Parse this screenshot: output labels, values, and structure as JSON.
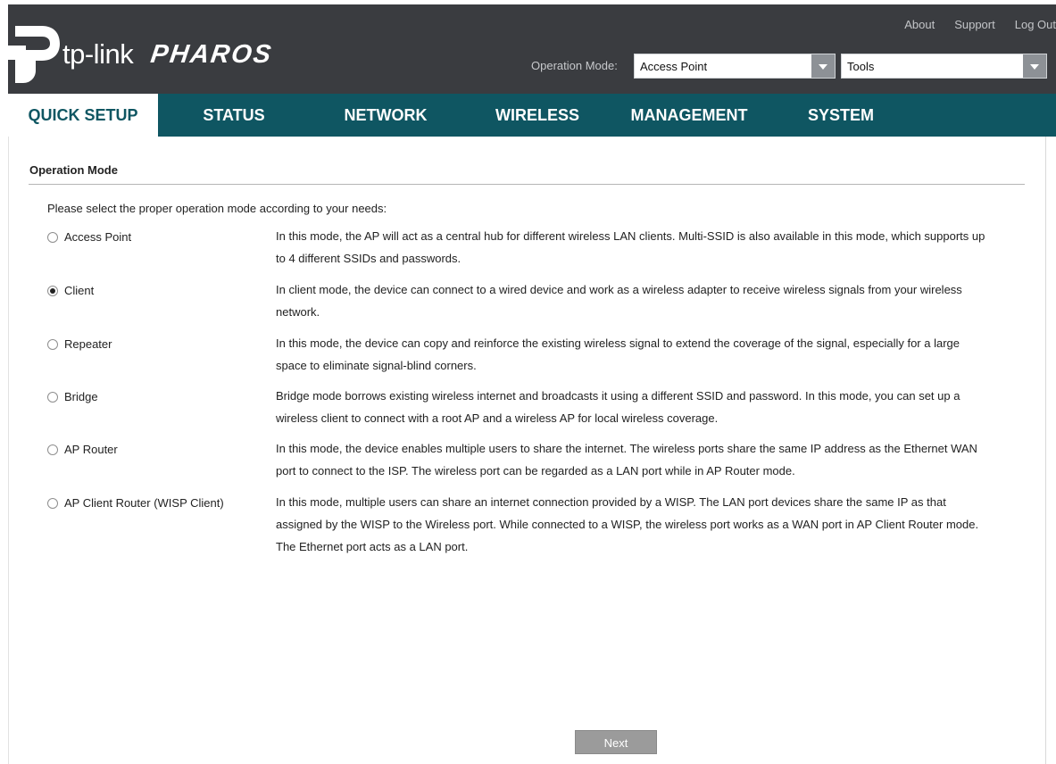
{
  "header": {
    "brand": "tp-link",
    "product": "PHAROS",
    "links": [
      "About",
      "Support",
      "Log Out"
    ],
    "operation_mode_label": "Operation Mode:",
    "operation_mode_value": "Access Point",
    "tools_value": "Tools"
  },
  "nav": {
    "tabs": [
      {
        "label": "QUICK SETUP",
        "active": true
      },
      {
        "label": "STATUS",
        "active": false
      },
      {
        "label": "NETWORK",
        "active": false
      },
      {
        "label": "WIRELESS",
        "active": false
      },
      {
        "label": "MANAGEMENT",
        "active": false
      },
      {
        "label": "SYSTEM",
        "active": false
      }
    ]
  },
  "main": {
    "section_title": "Operation Mode",
    "intro": "Please select the proper operation mode according to your needs:",
    "modes": [
      {
        "label": "Access Point",
        "checked": false,
        "desc": "In this mode, the AP will act as a central hub for different wireless LAN clients. Multi-SSID is also available in this mode, which supports up to 4 different SSIDs and passwords."
      },
      {
        "label": "Client",
        "checked": true,
        "desc": "In client mode, the device can connect to a wired device and work as a wireless adapter to receive wireless signals from your wireless network."
      },
      {
        "label": "Repeater",
        "checked": false,
        "desc": "In this mode, the device can copy and reinforce the existing wireless signal to extend the coverage of the signal, especially for a large space to eliminate signal-blind corners."
      },
      {
        "label": "Bridge",
        "checked": false,
        "desc": "Bridge mode borrows existing wireless internet and broadcasts it using a different SSID and password. In this mode, you can set up a wireless client to connect with a root AP and a wireless AP for local wireless coverage."
      },
      {
        "label": "AP Router",
        "checked": false,
        "desc": "In this mode, the device enables multiple users to share the internet. The wireless ports share the same IP address as the Ethernet WAN port to connect to the ISP. The wireless port can be regarded as a LAN port while in AP Router mode."
      },
      {
        "label": "AP Client Router (WISP Client)",
        "checked": false,
        "desc": "In this mode, multiple users can share an internet connection provided by a WISP. The LAN port devices share the same IP as that assigned by the WISP to the Wireless port. While connected to a WISP, the wireless port works as a WAN port in AP Client Router mode. The Ethernet port acts as a LAN port."
      }
    ],
    "next_label": "Next"
  },
  "colors": {
    "header_bg": "#3a3c40",
    "nav_bg": "#0f5662",
    "button_bg": "#9b9b9b"
  }
}
